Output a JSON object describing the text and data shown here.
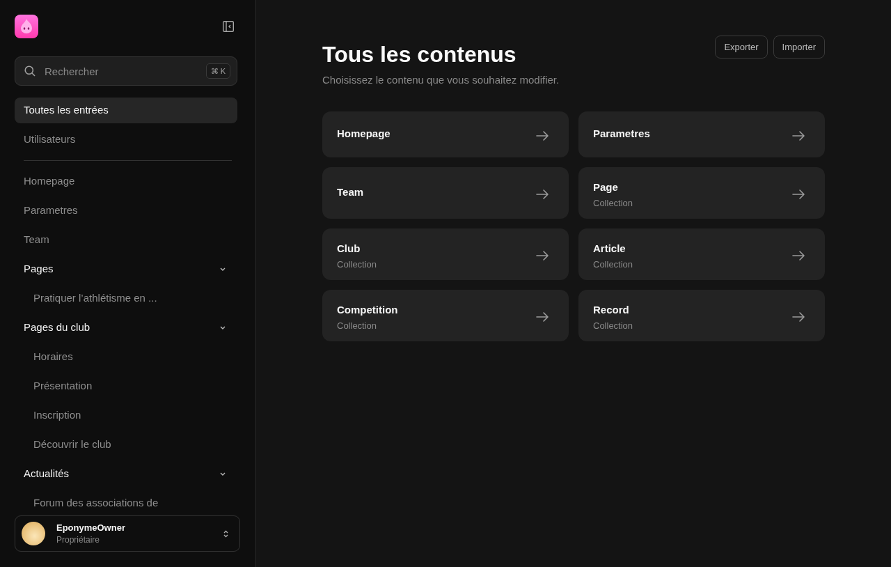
{
  "sidebar": {
    "search": {
      "placeholder": "Rechercher",
      "shortcut": "⌘ K"
    },
    "items": [
      {
        "label": "Toutes les entrées",
        "selected": true
      },
      {
        "label": "Utilisateurs",
        "selected": false
      }
    ],
    "entries": [
      {
        "kind": "link",
        "label": "Homepage",
        "selected": false
      },
      {
        "kind": "link",
        "label": "Parametres",
        "selected": false
      },
      {
        "kind": "link",
        "label": "Team",
        "selected": false
      },
      {
        "kind": "group",
        "label": "Pages",
        "selected": false,
        "expanded": true,
        "children": [
          {
            "label": "Pratiquer l’athlétisme en ...",
            "selected": false
          }
        ]
      },
      {
        "kind": "group",
        "label": "Pages du club",
        "selected": false,
        "expanded": true,
        "children": [
          {
            "label": "Horaires",
            "selected": false
          },
          {
            "label": "Présentation",
            "selected": false
          },
          {
            "label": "Inscription",
            "selected": false
          },
          {
            "label": "Découvrir le club",
            "selected": false
          }
        ]
      },
      {
        "kind": "group",
        "label": "Actualités",
        "selected": false,
        "expanded": true,
        "children": [
          {
            "label": "Forum des associations de",
            "selected": false
          }
        ]
      }
    ],
    "user": {
      "name": "EponymeOwner",
      "role": "Propriétaire"
    }
  },
  "page": {
    "title": "Tous les contenus",
    "subtitle": "Choisissez le contenu que vous souhaitez modifier.",
    "buttons": [
      "Exporter",
      "Importer"
    ]
  },
  "cards": [
    {
      "title": "Homepage"
    },
    {
      "title": "Parametres"
    },
    {
      "title": "Team"
    },
    {
      "title": "Page",
      "subtitle": "Collection"
    },
    {
      "title": "Club",
      "subtitle": "Collection"
    },
    {
      "title": "Article",
      "subtitle": "Collection"
    },
    {
      "title": "Competition",
      "subtitle": "Collection"
    },
    {
      "title": "Record",
      "subtitle": "Collection"
    }
  ]
}
